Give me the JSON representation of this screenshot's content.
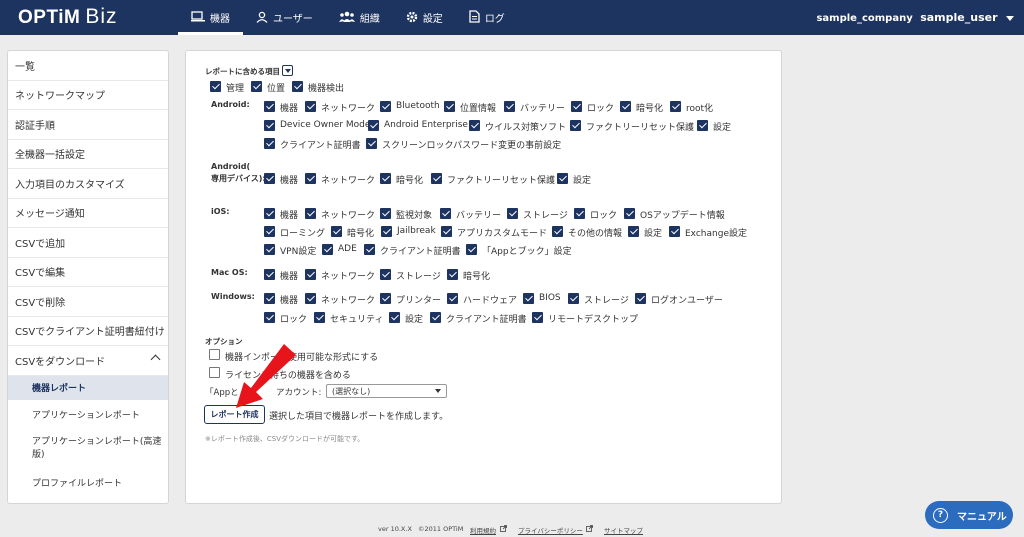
{
  "header": {
    "logo": "OPTiM",
    "logo_suffix": "Biz",
    "nav": [
      {
        "label": "機器",
        "icon": "device-icon"
      },
      {
        "label": "ユーザー",
        "icon": "user-icon"
      },
      {
        "label": "組織",
        "icon": "group-icon"
      },
      {
        "label": "設定",
        "icon": "gear-icon"
      },
      {
        "label": "ログ",
        "icon": "log-icon"
      }
    ],
    "company": "sample_company",
    "user": "sample_user"
  },
  "sidebar": {
    "items": [
      "一覧",
      "ネットワークマップ",
      "認証手順",
      "全機器一括設定",
      "入力項目のカスタマイズ",
      "メッセージ通知",
      "CSVで追加",
      "CSVで編集",
      "CSVで削除",
      "CSVでクライアント証明書紐付け",
      "CSVをダウンロード"
    ],
    "sub_items": [
      "機器レポート",
      "アプリケーションレポート",
      "アプリケーションレポート(高速版)",
      "プロファイルレポート"
    ]
  },
  "report": {
    "section_title": "レポートに含める項目",
    "common": [
      "管理",
      "位置",
      "機器検出"
    ],
    "android": {
      "label": "Android:",
      "items": [
        "機器",
        "ネットワーク",
        "Bluetooth",
        "位置情報",
        "バッテリー",
        "ロック",
        "暗号化",
        "root化",
        "Device Owner Mode",
        "Android Enterprise",
        "ウイルス対策ソフト",
        "ファクトリーリセット保護",
        "設定",
        "クライアント証明書",
        "スクリーンロックパスワード変更の事前設定"
      ]
    },
    "android_dedicated": {
      "label_lines": [
        "Android(",
        "専用デバイス):"
      ],
      "items": [
        "機器",
        "ネットワーク",
        "暗号化",
        "ファクトリーリセット保護",
        "設定"
      ]
    },
    "ios": {
      "label": "iOS:",
      "items": [
        "機器",
        "ネットワーク",
        "監視対象",
        "バッテリー",
        "ストレージ",
        "ロック",
        "OSアップデート情報",
        "ローミング",
        "暗号化",
        "Jailbreak",
        "アプリカスタムモード",
        "その他の情報",
        "設定",
        "Exchange設定",
        "VPN設定",
        "ADE",
        "クライアント証明書",
        "「Appとブック」設定"
      ]
    },
    "macos": {
      "label": "Mac OS:",
      "items": [
        "機器",
        "ネットワーク",
        "ストレージ",
        "暗号化"
      ]
    },
    "windows": {
      "label": "Windows:",
      "items": [
        "機器",
        "ネットワーク",
        "プリンター",
        "ハードウェア",
        "BIOS",
        "ストレージ",
        "ログオンユーザー",
        "ロック",
        "セキュリティ",
        "設定",
        "クライアント証明書",
        "リモートデスクトップ"
      ]
    },
    "options": {
      "title": "オプション",
      "opt1": "機器インポート使用可能な形式にする",
      "opt2": "ライセンス待ちの機器を含める",
      "account_label_a": "「Appと",
      "account_label_b": "アカウント:",
      "account_value": "(選択なし)"
    },
    "create_button": "レポート作成",
    "create_desc": "選択した項目で機器レポートを作成します。",
    "note": "※レポート作成後、CSVダウンロードが可能です。"
  },
  "footer": {
    "version": "ver 10.X.X",
    "copyright": "©2011 OPTiM",
    "terms": "利用規約",
    "privacy": "プライバシーポリシー",
    "sitemap": "サイトマップ"
  },
  "help_button": "マニュアル",
  "colors": {
    "navy": "#1d3360",
    "help_blue": "#2b6cbf",
    "arrow_red": "#e8141b"
  }
}
